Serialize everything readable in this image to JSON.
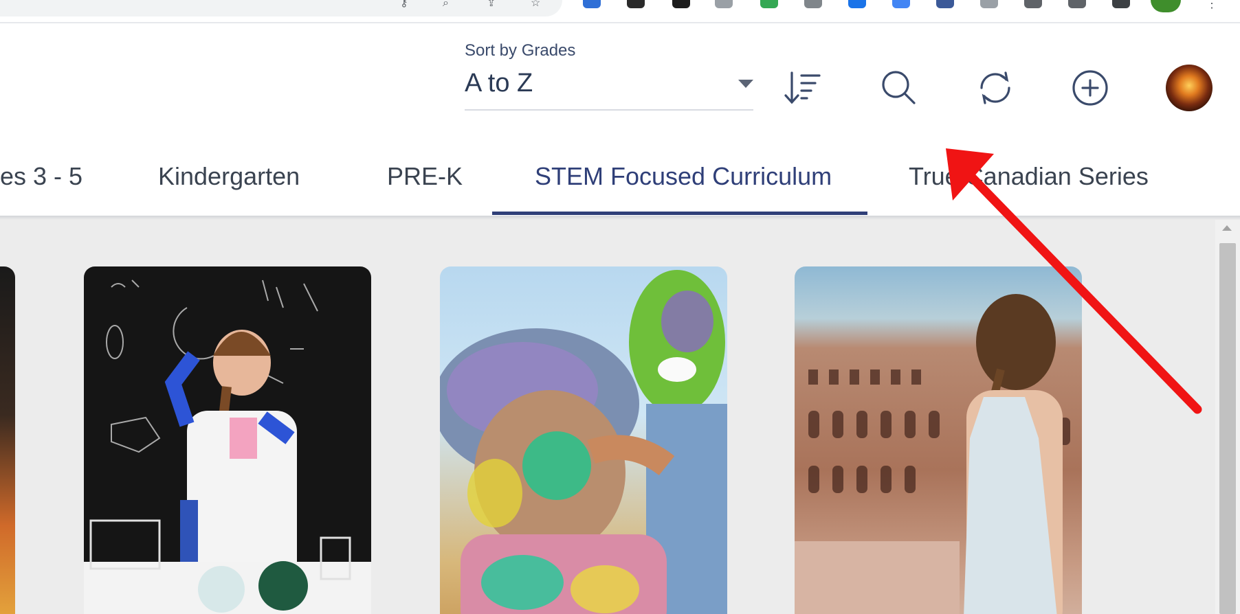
{
  "sort": {
    "label": "Sort by Grades",
    "value": "A to Z"
  },
  "toolbar": {
    "sort_direction_icon": "sort-order-icon",
    "search_icon": "search-icon",
    "refresh_icon": "refresh-icon",
    "add_icon": "add-circle-icon",
    "avatar_icon": "user-avatar"
  },
  "tabs": [
    {
      "label": "es 3 - 5",
      "active": false
    },
    {
      "label": "Kindergarten",
      "active": false
    },
    {
      "label": "PRE-K",
      "active": false
    },
    {
      "label": "STEM Focused Curriculum",
      "active": true
    },
    {
      "label": "True Canadian Series",
      "active": false
    }
  ],
  "colors": {
    "accent": "#2f3f78",
    "annotation_arrow": "#f01414",
    "content_background": "#ececec"
  }
}
